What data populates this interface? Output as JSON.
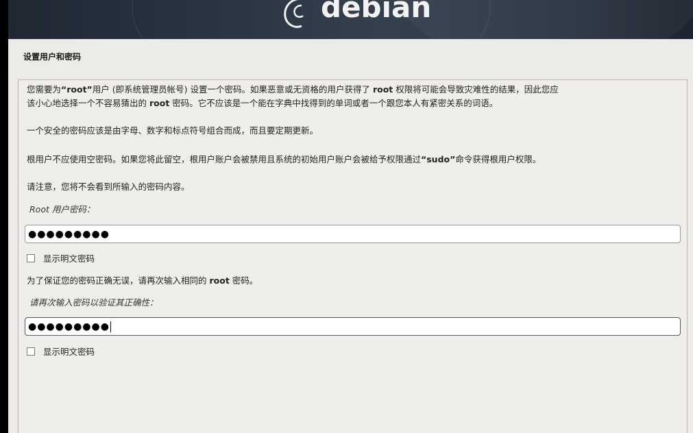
{
  "header": {
    "logo_text": "debian"
  },
  "page": {
    "title": "设置用户和密码"
  },
  "intro": {
    "line1_a": "您需要为",
    "line1_b": "“root”",
    "line1_c": "用户 (即系统管理员帐号) 设置一个密码。如果恶意或无资格的用户获得了 ",
    "line1_d": "root",
    "line1_e": " 权限将可能会导致灾难性的结果，因此您应",
    "line2_a": "该小心地选择一个不容易猜出的 ",
    "line2_b": "root",
    "line2_c": " 密码。它不应该是一个能在字典中找得到的单词或者一个跟您本人有紧密关系的词语。",
    "para2": "一个安全的密码应该是由字母、数字和标点符号组合而成，而且要定期更新。",
    "para3_a": "根用户不应使用空密码。如果您将此留空，根用户账户会被禁用且系统的初始用户账户会被给予权限通过",
    "para3_b": "“sudo”",
    "para3_c": "命令获得根用户权限。",
    "para4": "请注意，您将不会看到所输入的密码内容。"
  },
  "root_password": {
    "label": "Root 用户密码：",
    "value": "●●●●●●●●●",
    "show_label": "显示明文密码"
  },
  "verify": {
    "note_a": "为了保证您的密码正确无误，请再次输入相同的 ",
    "note_b": "root",
    "note_c": " 密码。",
    "label": "请再次输入密码以验证其正确性：",
    "value": "●●●●●●●●●",
    "show_label": "显示明文密码"
  }
}
